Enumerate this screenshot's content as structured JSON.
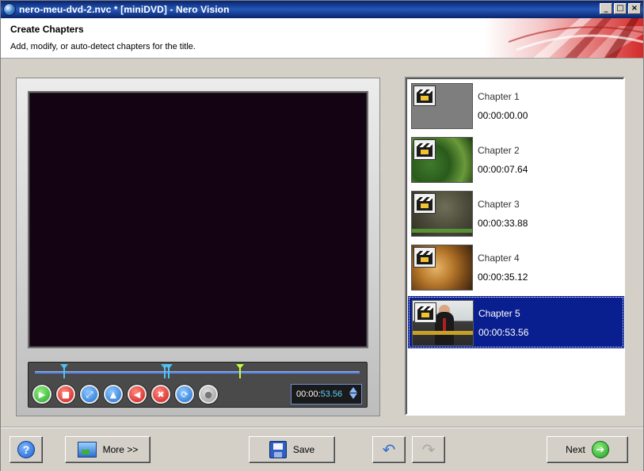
{
  "window": {
    "title": "nero-meu-dvd-2.nvc * [miniDVD] - Nero Vision",
    "minimize_glyph": "_",
    "maximize_glyph": "□",
    "close_glyph": "×"
  },
  "header": {
    "title": "Create Chapters",
    "subtitle": "Add, modify, or auto-detect chapters for the title."
  },
  "player": {
    "timecode_main": "00:00:",
    "timecode_sec": "53.56",
    "controls": [
      {
        "name": "play-button",
        "glyph": "▶",
        "style": "green"
      },
      {
        "name": "stop-button",
        "glyph": "■",
        "style": "red"
      },
      {
        "name": "fullscreen-button",
        "glyph": "⤢",
        "style": "blue"
      },
      {
        "name": "add-chapter-button",
        "glyph": "▲",
        "style": "blue"
      },
      {
        "name": "remove-chapter-button",
        "glyph": "◀",
        "style": "red"
      },
      {
        "name": "delete-all-chapters-button",
        "glyph": "✖",
        "style": "red"
      },
      {
        "name": "auto-detect-button",
        "glyph": "⟳",
        "style": "blue"
      },
      {
        "name": "disabled-option-button",
        "glyph": "●",
        "style": "grey"
      }
    ],
    "marker_colors": {
      "chapter": "#4fc3f7",
      "position": "#c6ff3a"
    }
  },
  "chapters": [
    {
      "name": "Chapter 1",
      "time": "00:00:00.00",
      "thumb": "t1",
      "selected": false
    },
    {
      "name": "Chapter 2",
      "time": "00:00:07.64",
      "thumb": "t2",
      "selected": false
    },
    {
      "name": "Chapter 3",
      "time": "00:00:33.88",
      "thumb": "t3",
      "selected": false
    },
    {
      "name": "Chapter 4",
      "time": "00:00:35.12",
      "thumb": "t4",
      "selected": false
    },
    {
      "name": "Chapter 5",
      "time": "00:00:53.56",
      "thumb": "t5",
      "selected": true
    }
  ],
  "toolbar": {
    "help_glyph": "?",
    "more_label": "More >>",
    "save_label": "Save",
    "undo_glyph": "↶",
    "redo_glyph": "↷",
    "next_label": "Next",
    "next_glyph": "➔"
  },
  "colors": {
    "title_bar": "#0a246a",
    "selection": "#0a1f8f",
    "timeline": "#5a82d8"
  }
}
